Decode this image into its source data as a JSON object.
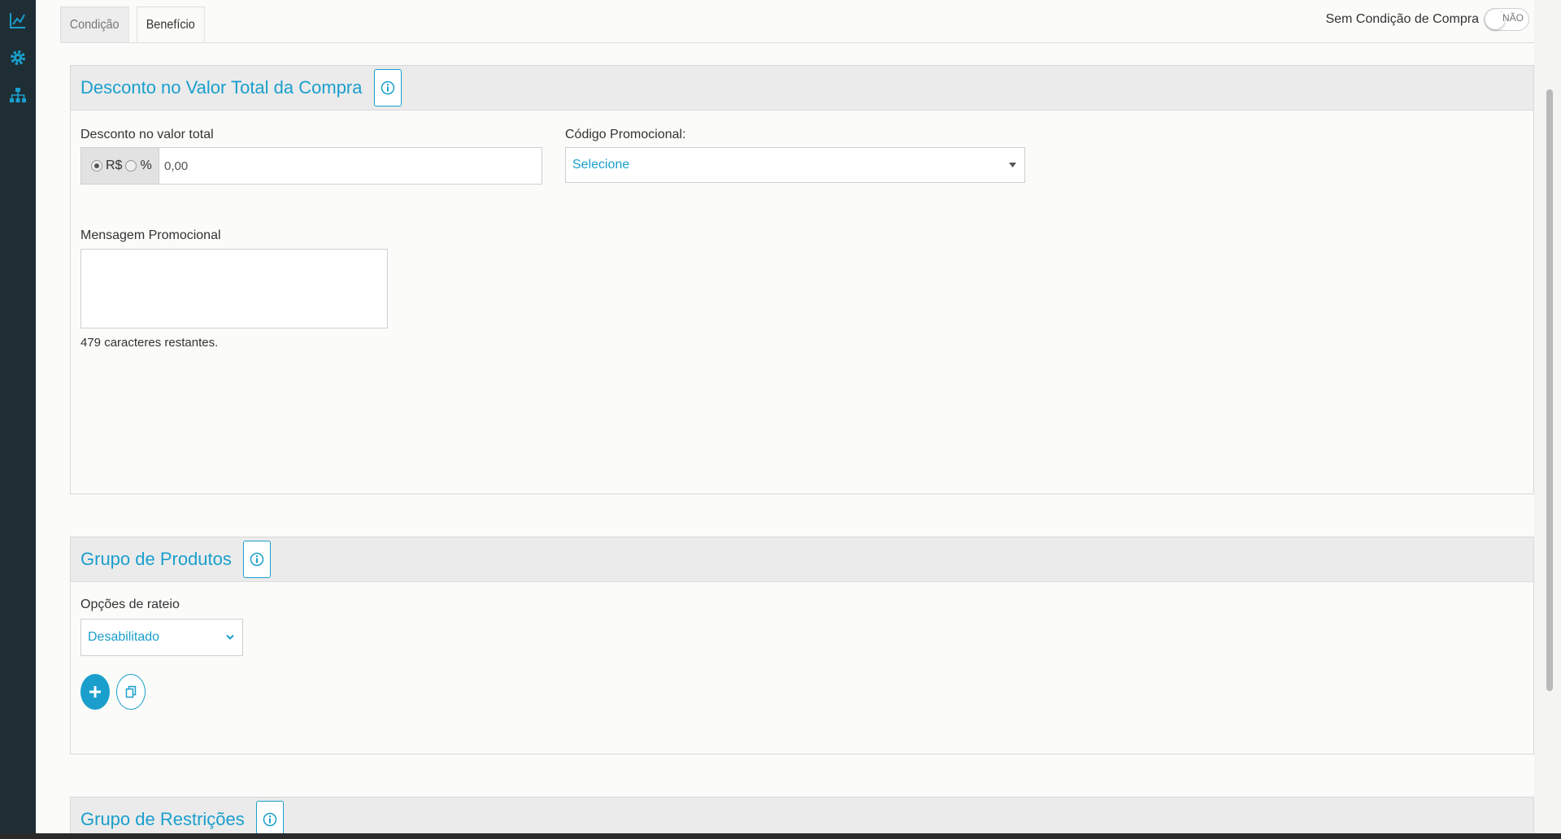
{
  "tabs": [
    {
      "label": "Condição",
      "active": false
    },
    {
      "label": "Benefício",
      "active": true
    }
  ],
  "toggle": {
    "label": "Sem Condição de Compra",
    "value_text": "NÃO"
  },
  "panel1": {
    "title": "Desconto no Valor Total da Compra",
    "discount_label": "Desconto no valor total",
    "radio_rs": "R$",
    "radio_percent": "%",
    "discount_value": "0,00",
    "promo_code_label": "Código Promocional:",
    "promo_code_select": "Selecione",
    "message_label": "Mensagem Promocional",
    "chars_remaining": "479 caracteres restantes."
  },
  "panel2": {
    "title": "Grupo de Produtos",
    "rateio_label": "Opções de rateio",
    "rateio_select": "Desabilitado"
  },
  "panel3": {
    "title": "Grupo de Restrições"
  },
  "colors": {
    "accent": "#1a9fcc",
    "sidebar": "#1f2e35"
  }
}
